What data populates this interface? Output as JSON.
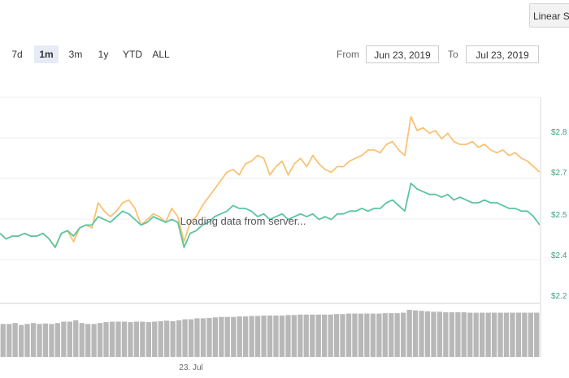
{
  "scale_button": {
    "label": "Linear Scale"
  },
  "range_selector": {
    "buttons": [
      {
        "label": "7d",
        "active": false
      },
      {
        "label": "1m",
        "active": true
      },
      {
        "label": "3m",
        "active": false
      },
      {
        "label": "1y",
        "active": false
      },
      {
        "label": "YTD",
        "active": false
      },
      {
        "label": "ALL",
        "active": false
      }
    ],
    "from_label": "From",
    "from_value": "Jun 23, 2019",
    "to_label": "To",
    "to_value": "Jul 23, 2019"
  },
  "loading_text": "Loading data from server...",
  "colors": {
    "price_series": "#f8c373",
    "market_series": "#5cc4a0",
    "volume_bars": "#b8b8b8",
    "axis_label": "#3fa37a",
    "active_button_bg": "#e6ebf5"
  },
  "chart_data": {
    "type": "line",
    "ylabels": [
      "$2.8",
      "$2.7",
      "$2.5",
      "$2.4",
      "$2.2"
    ],
    "xlabels": [
      "23. Jul"
    ],
    "series": [
      {
        "color": "#f8c373",
        "values": [
          2.44,
          2.42,
          2.43,
          2.43,
          2.44,
          2.43,
          2.43,
          2.44,
          2.42,
          2.39,
          2.44,
          2.45,
          2.41,
          2.46,
          2.47,
          2.46,
          2.55,
          2.52,
          2.5,
          2.52,
          2.55,
          2.56,
          2.53,
          2.47,
          2.49,
          2.51,
          2.5,
          2.48,
          2.53,
          2.5,
          2.41,
          2.48,
          2.5,
          2.54,
          2.57,
          2.6,
          2.63,
          2.66,
          2.67,
          2.65,
          2.69,
          2.7,
          2.72,
          2.71,
          2.65,
          2.68,
          2.7,
          2.65,
          2.69,
          2.71,
          2.68,
          2.72,
          2.69,
          2.67,
          2.66,
          2.68,
          2.68,
          2.7,
          2.71,
          2.72,
          2.74,
          2.74,
          2.73,
          2.76,
          2.77,
          2.74,
          2.72,
          2.86,
          2.81,
          2.82,
          2.8,
          2.81,
          2.78,
          2.8,
          2.77,
          2.76,
          2.76,
          2.77,
          2.75,
          2.76,
          2.74,
          2.73,
          2.74,
          2.72,
          2.73,
          2.71,
          2.7,
          2.68,
          2.66
        ]
      },
      {
        "color": "#5cc4a0",
        "values": [
          2.44,
          2.42,
          2.43,
          2.43,
          2.44,
          2.43,
          2.43,
          2.44,
          2.42,
          2.39,
          2.44,
          2.45,
          2.43,
          2.46,
          2.47,
          2.47,
          2.5,
          2.49,
          2.48,
          2.5,
          2.52,
          2.51,
          2.49,
          2.47,
          2.48,
          2.5,
          2.49,
          2.48,
          2.49,
          2.48,
          2.39,
          2.44,
          2.45,
          2.47,
          2.48,
          2.5,
          2.51,
          2.52,
          2.54,
          2.53,
          2.53,
          2.52,
          2.5,
          2.51,
          2.49,
          2.5,
          2.51,
          2.49,
          2.5,
          2.51,
          2.5,
          2.51,
          2.49,
          2.5,
          2.49,
          2.51,
          2.51,
          2.52,
          2.52,
          2.53,
          2.52,
          2.53,
          2.53,
          2.55,
          2.56,
          2.54,
          2.52,
          2.62,
          2.6,
          2.59,
          2.58,
          2.58,
          2.57,
          2.58,
          2.56,
          2.57,
          2.56,
          2.55,
          2.55,
          2.56,
          2.55,
          2.55,
          2.54,
          2.53,
          2.53,
          2.52,
          2.52,
          2.5,
          2.47
        ]
      }
    ],
    "volume": [
      0.7,
      0.7,
      0.72,
      0.68,
      0.7,
      0.72,
      0.7,
      0.71,
      0.7,
      0.72,
      0.75,
      0.75,
      0.78,
      0.72,
      0.7,
      0.7,
      0.72,
      0.74,
      0.75,
      0.75,
      0.75,
      0.74,
      0.75,
      0.75,
      0.74,
      0.75,
      0.76,
      0.77,
      0.76,
      0.78,
      0.8,
      0.8,
      0.82,
      0.82,
      0.83,
      0.84,
      0.85,
      0.85,
      0.85,
      0.86,
      0.86,
      0.87,
      0.87,
      0.88,
      0.88,
      0.88,
      0.88,
      0.89,
      0.89,
      0.9,
      0.9,
      0.9,
      0.9,
      0.9,
      0.9,
      0.91,
      0.91,
      0.92,
      0.92,
      0.92,
      0.92,
      0.92,
      0.92,
      0.93,
      0.93,
      0.93,
      0.94,
      1.0,
      0.99,
      0.98,
      0.97,
      0.96,
      0.96,
      0.95,
      0.95,
      0.95,
      0.95,
      0.94,
      0.94,
      0.94,
      0.94,
      0.94,
      0.94,
      0.94,
      0.94,
      0.94,
      0.94,
      0.94,
      0.94
    ],
    "ylim": [
      2.2,
      2.9
    ],
    "grid": true,
    "legend": false
  }
}
